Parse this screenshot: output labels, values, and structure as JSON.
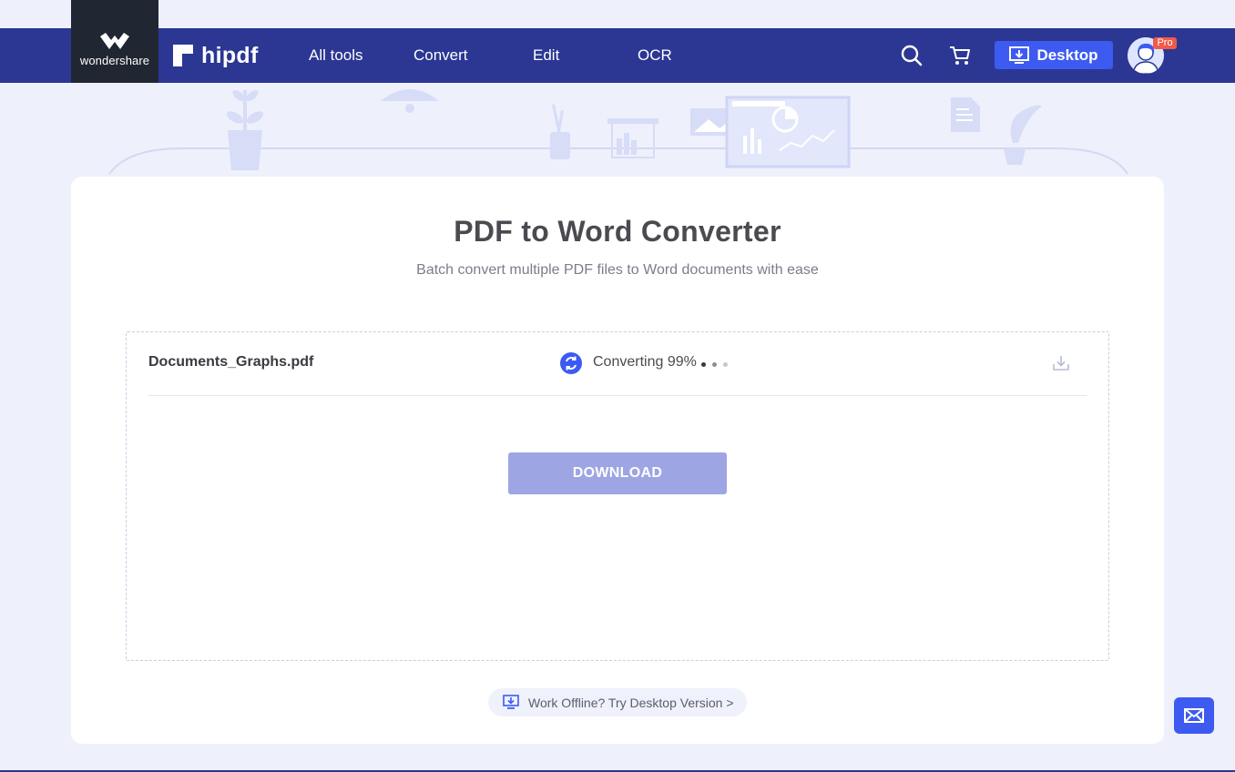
{
  "colors": {
    "nav_bg": "#2b3793",
    "accent": "#3d5af1",
    "logo_bg": "#202632",
    "page_bg": "#eef0fb",
    "download_disabled": "#9da5e3",
    "pro_badge": "#f05a4a",
    "status_dot_dark": "#3a3a40",
    "status_dot_mid": "#8a8e9a",
    "status_dot_light": "#c4c7d2"
  },
  "header": {
    "company_logo_text": "wondershare",
    "brand_name": "hipdf",
    "nav": [
      {
        "label": "All tools"
      },
      {
        "label": "Convert"
      },
      {
        "label": "Edit"
      },
      {
        "label": "OCR"
      }
    ],
    "icons": [
      "search-icon",
      "cart-icon",
      "desktop-download-icon",
      "avatar"
    ],
    "desktop_button_label": "Desktop",
    "pro_badge": "Pro"
  },
  "main": {
    "title": "PDF to Word Converter",
    "subtitle": "Batch convert multiple PDF files to Word documents with ease",
    "files": [
      {
        "name": "Documents_Graphs.pdf",
        "status": "Converting 99%",
        "status_icon": "sync-icon",
        "action_icon": "download-icon"
      }
    ],
    "download_button_label": "DOWNLOAD",
    "offline_prompt": "Work Offline? Try Desktop Version >"
  },
  "feedback": {
    "icon": "mail-icon"
  }
}
